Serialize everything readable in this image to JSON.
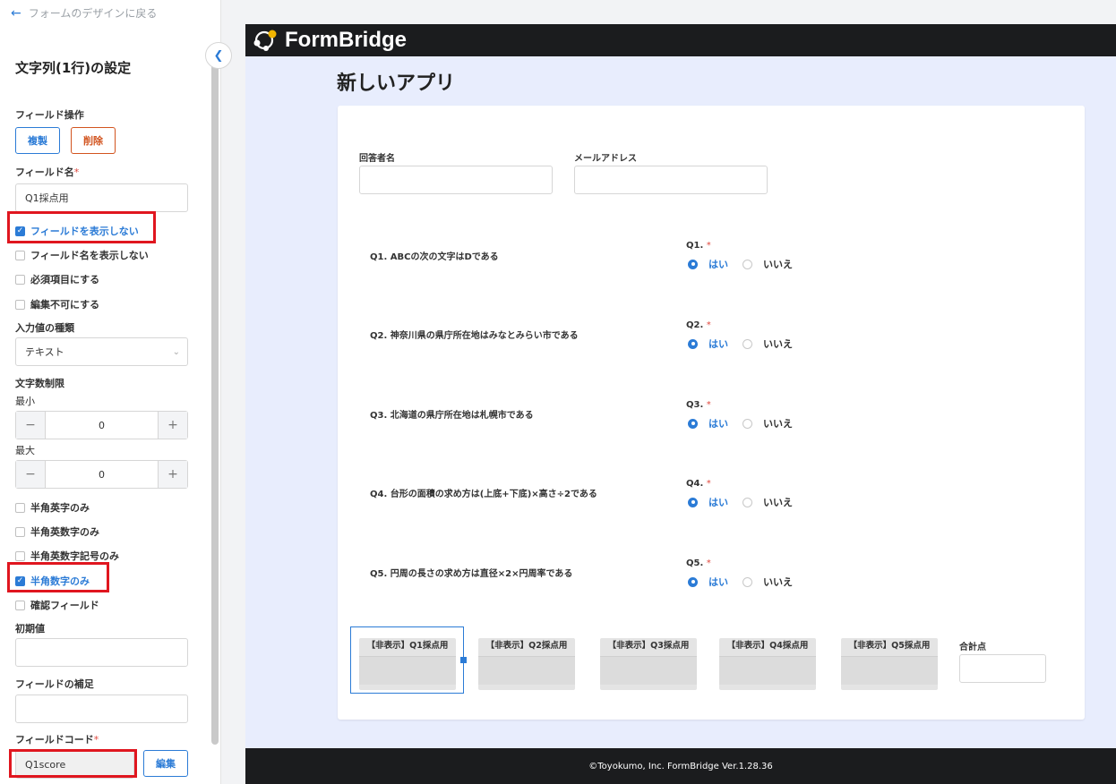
{
  "panel": {
    "back_label": "フォームのデザインに戻る",
    "title": "文字列(1行)の設定",
    "field_ops_label": "フィールド操作",
    "duplicate_label": "複製",
    "delete_label": "削除",
    "field_name_label": "フィールド名",
    "required_mark": "*",
    "field_name_value": "Q1採点用",
    "checkboxes_top": [
      {
        "label": "フィールドを表示しない",
        "checked": true
      },
      {
        "label": "フィールド名を表示しない",
        "checked": false
      },
      {
        "label": "必須項目にする",
        "checked": false
      },
      {
        "label": "編集不可にする",
        "checked": false
      }
    ],
    "input_type_label": "入力値の種類",
    "input_type_value": "テキスト",
    "char_limit_label": "文字数制限",
    "min_label": "最小",
    "min_value": "0",
    "max_label": "最大",
    "max_value": "0",
    "checkboxes_bottom": [
      {
        "label": "半角英字のみ",
        "checked": false
      },
      {
        "label": "半角英数字のみ",
        "checked": false
      },
      {
        "label": "半角英数字記号のみ",
        "checked": false
      },
      {
        "label": "半角数字のみ",
        "checked": true
      },
      {
        "label": "確認フィールド",
        "checked": false
      }
    ],
    "initial_value_label": "初期値",
    "supplement_label": "フィールドの補足",
    "field_code_label": "フィールドコード",
    "field_code_value": "Q1score",
    "edit_label": "編集"
  },
  "preview": {
    "brand": "FormBridge",
    "app_title": "新しいアプリ",
    "respondent_label": "回答者名",
    "email_label": "メールアドレス",
    "questions": [
      {
        "text": "Q1. ABCの次の文字はDである",
        "label": "Q1.",
        "yes": "はい",
        "no": "いいえ"
      },
      {
        "text": "Q2. 神奈川県の県庁所在地はみなとみらい市である",
        "label": "Q2.",
        "yes": "はい",
        "no": "いいえ"
      },
      {
        "text": "Q3. 北海道の県庁所在地は札幌市である",
        "label": "Q3.",
        "yes": "はい",
        "no": "いいえ"
      },
      {
        "text": "Q4. 台形の面積の求め方は(上底+下底)×高さ÷2である",
        "label": "Q4.",
        "yes": "はい",
        "no": "いいえ"
      },
      {
        "text": "Q5. 円周の長さの求め方は直径×2×円周率である",
        "label": "Q5.",
        "yes": "はい",
        "no": "いいえ"
      }
    ],
    "hidden_fields": [
      "【非表示】Q1採点用",
      "【非表示】Q2採点用",
      "【非表示】Q3採点用",
      "【非表示】Q4採点用",
      "【非表示】Q5採点用"
    ],
    "total_label": "合計点",
    "footer": "©Toyokumo, Inc. FormBridge Ver.1.28.36"
  },
  "colors": {
    "accent": "#2b7bd6",
    "danger": "#d2541f",
    "highlight": "#e0161f",
    "dark_bar": "#1b1c1e",
    "preview_bg": "#e8edfd"
  }
}
